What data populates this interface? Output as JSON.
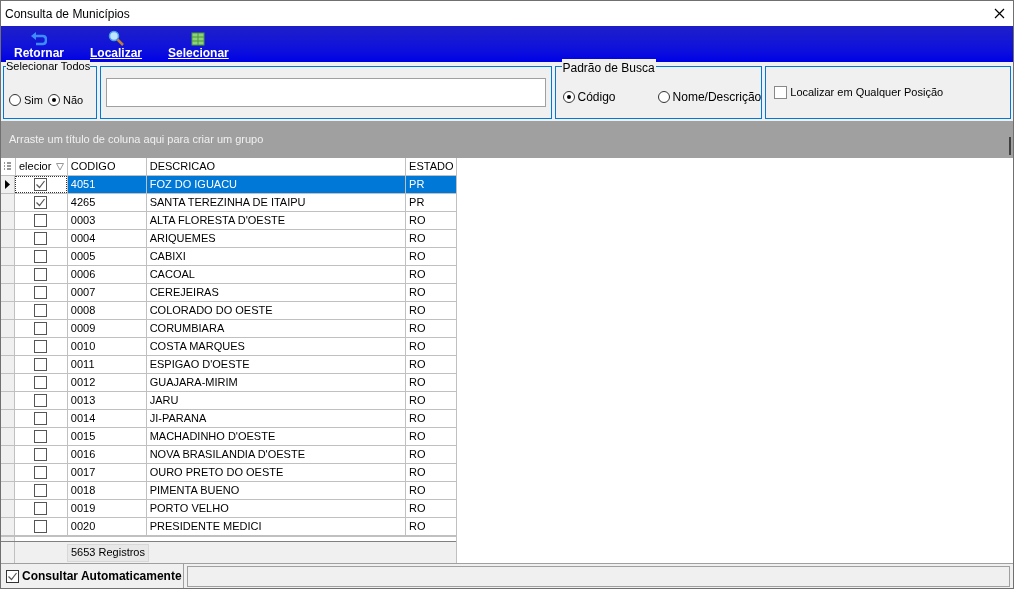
{
  "window": {
    "title": "Consulta de Municípios"
  },
  "toolbar": [
    {
      "label": "Retornar",
      "kind": "back"
    },
    {
      "label": "Localizar",
      "kind": "search"
    },
    {
      "label": "Selecionar",
      "kind": "grid"
    }
  ],
  "select_all": {
    "title": "Selecionar Todos",
    "options": [
      {
        "label": "Sim",
        "selected": false
      },
      {
        "label": "Não",
        "selected": true
      }
    ]
  },
  "search_pattern": {
    "title": "Padrão de Busca",
    "options": [
      {
        "label": "Código",
        "selected": true
      },
      {
        "label": "Nome/Descrição",
        "selected": false
      }
    ]
  },
  "any_position": {
    "label": "Localizar em Qualquer Posição",
    "checked": false
  },
  "group_panel": {
    "hint": "Arraste um título de coluna aqui para criar um grupo"
  },
  "table": {
    "columns": [
      "elecior",
      "CODIGO",
      "DESCRICAO",
      "ESTADO"
    ],
    "rows": [
      {
        "checked": true,
        "selected": true,
        "codigo": "4051",
        "descricao": "FOZ DO IGUACU",
        "estado": "PR"
      },
      {
        "checked": true,
        "selected": false,
        "codigo": "4265",
        "descricao": "SANTA TEREZINHA DE ITAIPU",
        "estado": "PR"
      },
      {
        "checked": false,
        "selected": false,
        "codigo": "0003",
        "descricao": "ALTA FLORESTA D'OESTE",
        "estado": "RO"
      },
      {
        "checked": false,
        "selected": false,
        "codigo": "0004",
        "descricao": "ARIQUEMES",
        "estado": "RO"
      },
      {
        "checked": false,
        "selected": false,
        "codigo": "0005",
        "descricao": "CABIXI",
        "estado": "RO"
      },
      {
        "checked": false,
        "selected": false,
        "codigo": "0006",
        "descricao": "CACOAL",
        "estado": "RO"
      },
      {
        "checked": false,
        "selected": false,
        "codigo": "0007",
        "descricao": "CEREJEIRAS",
        "estado": "RO"
      },
      {
        "checked": false,
        "selected": false,
        "codigo": "0008",
        "descricao": "COLORADO DO OESTE",
        "estado": "RO"
      },
      {
        "checked": false,
        "selected": false,
        "codigo": "0009",
        "descricao": "CORUMBIARA",
        "estado": "RO"
      },
      {
        "checked": false,
        "selected": false,
        "codigo": "0010",
        "descricao": "COSTA MARQUES",
        "estado": "RO"
      },
      {
        "checked": false,
        "selected": false,
        "codigo": "0011",
        "descricao": "ESPIGAO D'OESTE",
        "estado": "RO"
      },
      {
        "checked": false,
        "selected": false,
        "codigo": "0012",
        "descricao": "GUAJARA-MIRIM",
        "estado": "RO"
      },
      {
        "checked": false,
        "selected": false,
        "codigo": "0013",
        "descricao": "JARU",
        "estado": "RO"
      },
      {
        "checked": false,
        "selected": false,
        "codigo": "0014",
        "descricao": "JI-PARANA",
        "estado": "RO"
      },
      {
        "checked": false,
        "selected": false,
        "codigo": "0015",
        "descricao": "MACHADINHO D'OESTE",
        "estado": "RO"
      },
      {
        "checked": false,
        "selected": false,
        "codigo": "0016",
        "descricao": "NOVA BRASILANDIA D'OESTE",
        "estado": "RO"
      },
      {
        "checked": false,
        "selected": false,
        "codigo": "0017",
        "descricao": "OURO PRETO DO OESTE",
        "estado": "RO"
      },
      {
        "checked": false,
        "selected": false,
        "codigo": "0018",
        "descricao": "PIMENTA BUENO",
        "estado": "RO"
      },
      {
        "checked": false,
        "selected": false,
        "codigo": "0019",
        "descricao": "PORTO VELHO",
        "estado": "RO"
      },
      {
        "checked": false,
        "selected": false,
        "codigo": "0020",
        "descricao": "PRESIDENTE MEDICI",
        "estado": "RO"
      }
    ],
    "footer": "5653 Registros"
  },
  "auto_query": {
    "label": "Consultar Automaticamente",
    "checked": true
  }
}
